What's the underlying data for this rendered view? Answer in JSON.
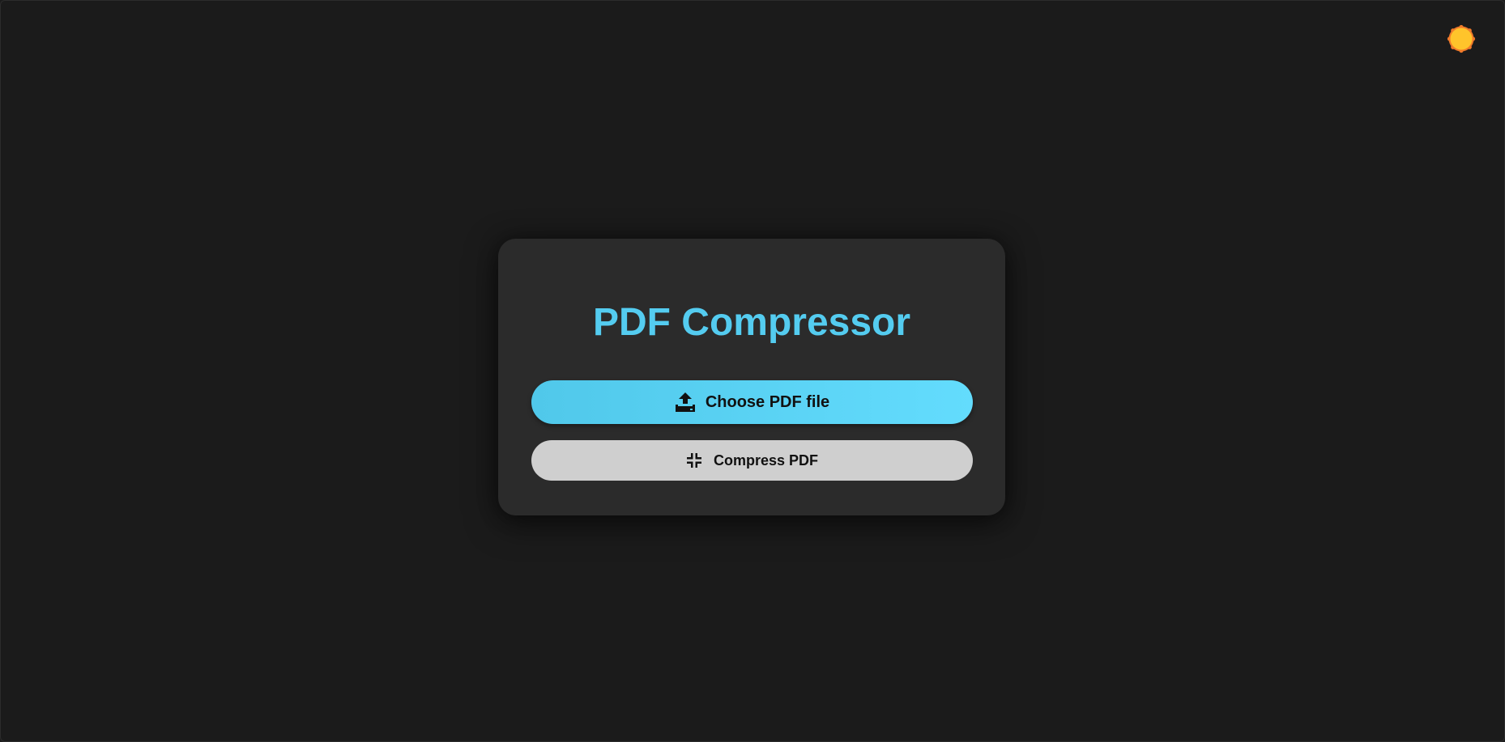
{
  "app": {
    "title": "PDF Compressor"
  },
  "header": {
    "theme_toggle_icon": "sun-icon",
    "sun_color": "#ffc42b",
    "sun_rim_color": "#f07a2a"
  },
  "actions": {
    "choose_label": "Choose PDF file",
    "choose_icon": "upload-icon",
    "compress_label": "Compress PDF",
    "compress_icon": "collapse-icon"
  },
  "colors": {
    "background": "#1b1b1b",
    "card": "#2b2b2b",
    "accent": "#54ccf0",
    "secondary_button": "#cfcfcf"
  }
}
